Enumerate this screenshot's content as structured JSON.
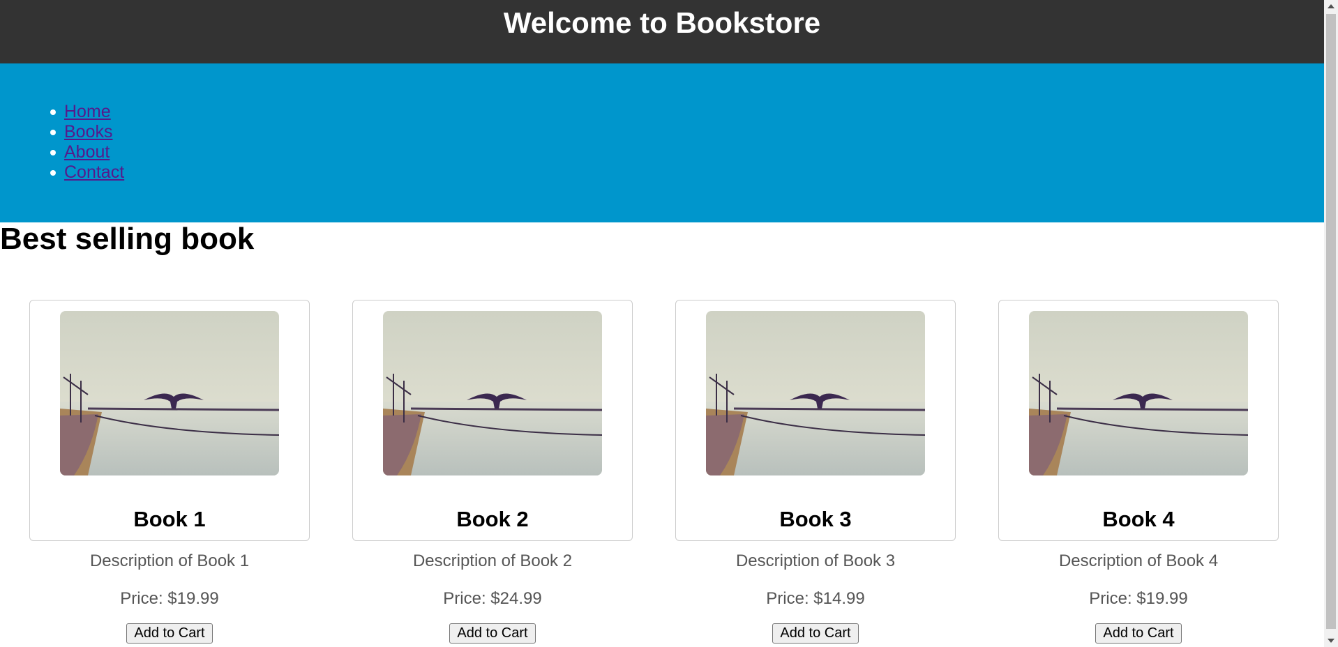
{
  "header": {
    "title": "Welcome to Bookstore"
  },
  "nav": {
    "items": [
      {
        "label": "Home"
      },
      {
        "label": "Books"
      },
      {
        "label": "About"
      },
      {
        "label": "Contact"
      }
    ]
  },
  "section": {
    "title": "Best selling book"
  },
  "books": [
    {
      "title": "Book 1",
      "description": "Description of Book 1",
      "price": "Price: $19.99",
      "button": "Add to Cart"
    },
    {
      "title": "Book 2",
      "description": "Description of Book 2",
      "price": "Price: $24.99",
      "button": "Add to Cart"
    },
    {
      "title": "Book 3",
      "description": "Description of Book 3",
      "price": "Price: $14.99",
      "button": "Add to Cart"
    },
    {
      "title": "Book 4",
      "description": "Description of Book 4",
      "price": "Price: $19.99",
      "button": "Add to Cart"
    }
  ],
  "colors": {
    "header_bg": "#333333",
    "nav_bg": "#0096cc",
    "link": "#551a8b",
    "muted_text": "#555555"
  }
}
